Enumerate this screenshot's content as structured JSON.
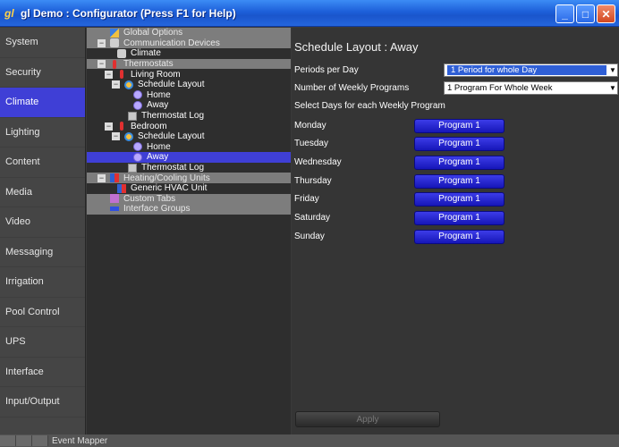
{
  "window": {
    "title": "gl Demo : Configurator   (Press F1 for Help)",
    "logo": "gl",
    "minimize_glyph": "_",
    "maximize_glyph": "□",
    "close_glyph": "✕"
  },
  "nav": {
    "items": [
      {
        "label": "System"
      },
      {
        "label": "Security"
      },
      {
        "label": "Climate",
        "active": true
      },
      {
        "label": "Lighting"
      },
      {
        "label": "Content"
      },
      {
        "label": "Media"
      },
      {
        "label": "Video"
      },
      {
        "label": "Messaging"
      },
      {
        "label": "Irrigation"
      },
      {
        "label": "Pool Control"
      },
      {
        "label": "UPS"
      },
      {
        "label": "Interface"
      },
      {
        "label": "Input/Output"
      }
    ],
    "partial_label": "Event Mapper"
  },
  "tree": {
    "items": [
      {
        "label": "Global Options",
        "icon": "global-icon"
      },
      {
        "label": "Communication Devices",
        "icon": "comm-icon"
      },
      {
        "label": "Climate",
        "icon": "comm-icon"
      },
      {
        "label": "Thermostats",
        "icon": "thermostat-icon"
      },
      {
        "label": "Living Room",
        "icon": "thermostat-icon"
      },
      {
        "label": "Schedule Layout",
        "icon": "schedule-icon"
      },
      {
        "label": "Home",
        "icon": "clock-icon"
      },
      {
        "label": "Away",
        "icon": "clock-icon"
      },
      {
        "label": "Thermostat Log",
        "icon": "log-icon"
      },
      {
        "label": "Bedroom",
        "icon": "thermostat-icon"
      },
      {
        "label": "Schedule Layout",
        "icon": "schedule-icon"
      },
      {
        "label": "Home",
        "icon": "clock-icon"
      },
      {
        "label": "Away",
        "icon": "clock-icon",
        "selected": true
      },
      {
        "label": "Thermostat Log",
        "icon": "log-icon"
      },
      {
        "label": "Heating/Cooling Units",
        "icon": "hvac-icon"
      },
      {
        "label": "Generic HVAC Unit",
        "icon": "hvac-icon"
      },
      {
        "label": "Custom Tabs",
        "icon": "tabs-icon"
      },
      {
        "label": "Interface Groups",
        "icon": "interface-icon"
      }
    ],
    "expand_glyph": "−"
  },
  "main": {
    "title": "Schedule Layout : Away",
    "periods_label": "Periods per Day",
    "periods_value": "1 Period for whole Day",
    "weekly_label": "Number of Weekly Programs",
    "weekly_value": "1 Program For Whole Week",
    "select_days_label": "Select Days for each Weekly Program",
    "dropdown_glyph": "▼",
    "days": [
      {
        "day": "Monday",
        "program": "Program 1"
      },
      {
        "day": "Tuesday",
        "program": "Program 1"
      },
      {
        "day": "Wednesday",
        "program": "Program 1"
      },
      {
        "day": "Thursday",
        "program": "Program 1"
      },
      {
        "day": "Friday",
        "program": "Program 1"
      },
      {
        "day": "Saturday",
        "program": "Program 1"
      },
      {
        "day": "Sunday",
        "program": "Program 1"
      }
    ],
    "apply_label": "Apply"
  }
}
